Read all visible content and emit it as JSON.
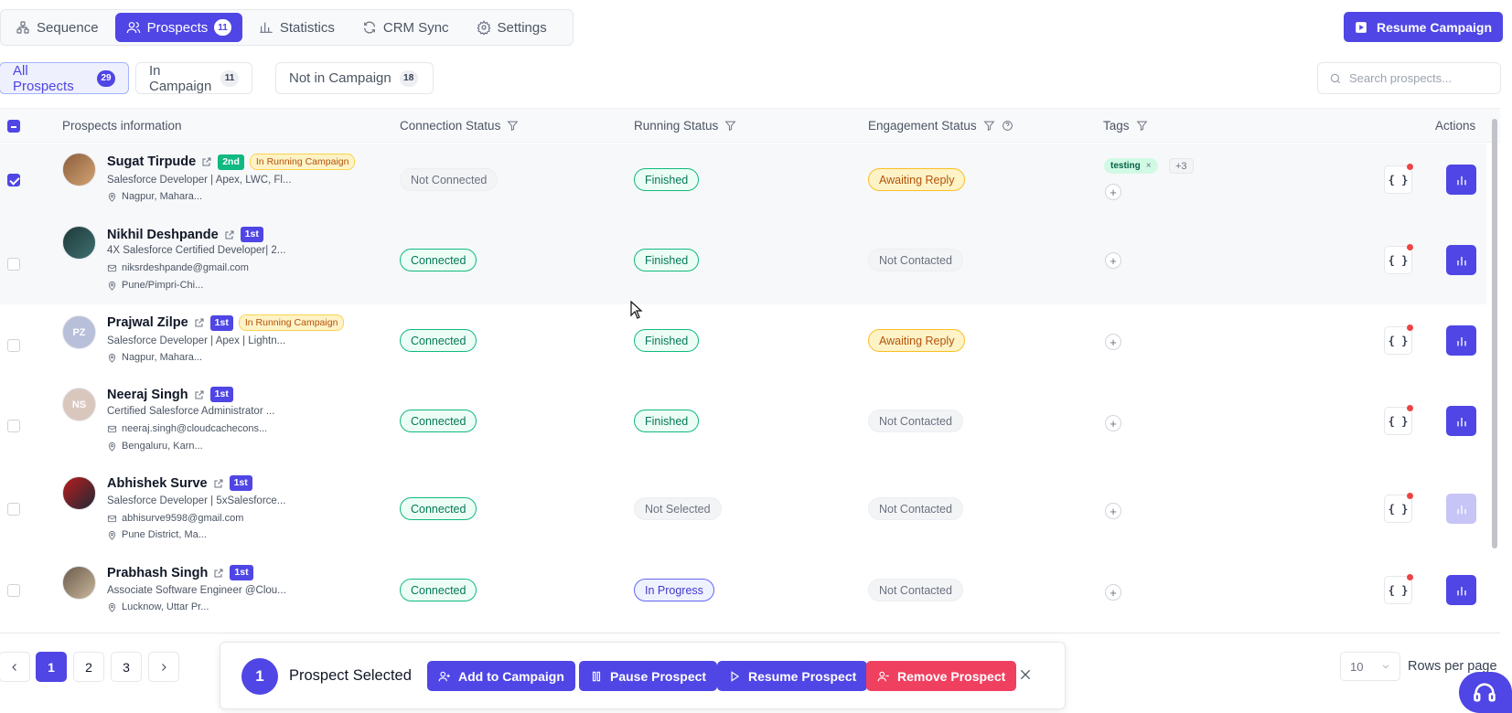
{
  "nav": {
    "tabs": [
      {
        "label": "Sequence",
        "icon": "sequence-icon"
      },
      {
        "label": "Prospects",
        "icon": "users-icon",
        "badge": "11"
      },
      {
        "label": "Statistics",
        "icon": "bar-chart-icon"
      },
      {
        "label": "CRM Sync",
        "icon": "sync-icon"
      },
      {
        "label": "Settings",
        "icon": "gear-icon"
      }
    ],
    "resume_campaign": "Resume Campaign"
  },
  "filters": {
    "tabs": [
      {
        "label": "All Prospects",
        "count": "29"
      },
      {
        "label": "In Campaign",
        "count": "11"
      },
      {
        "label": "Not in Campaign",
        "count": "18"
      }
    ],
    "search_placeholder": "Search prospects..."
  },
  "table": {
    "headers": {
      "info": "Prospects information",
      "connection": "Connection Status",
      "running": "Running Status",
      "engagement": "Engagement Status",
      "tags": "Tags",
      "actions": "Actions"
    },
    "rows": [
      {
        "name": "Sugat Tirpude",
        "degree": "2nd",
        "campaign_badge": "In Running Campaign",
        "title": "Salesforce Developer | Apex, LWC, Fl...",
        "email": "",
        "location": "Nagpur, Mahara...",
        "connection": "Not Connected",
        "running": "Finished",
        "engagement": "Awaiting Reply",
        "tag": "testing",
        "tag_more": "+3",
        "selected": true
      },
      {
        "name": "Nikhil Deshpande",
        "degree": "1st",
        "campaign_badge": "",
        "title": "4X Salesforce Certified Developer| 2...",
        "email": "niksrdeshpande@gmail.com",
        "location": "Pune/Pimpri-Chi...",
        "connection": "Connected",
        "running": "Finished",
        "engagement": "Not Contacted",
        "tag": "",
        "tag_more": "",
        "selected": false
      },
      {
        "name": "Prajwal Zilpe",
        "degree": "1st",
        "campaign_badge": "In Running Campaign",
        "title": "Salesforce Developer | Apex | Lightn...",
        "email": "",
        "location": "Nagpur, Mahara...",
        "connection": "Connected",
        "running": "Finished",
        "engagement": "Awaiting Reply",
        "tag": "",
        "tag_more": "",
        "selected": false,
        "initials": "PZ"
      },
      {
        "name": "Neeraj Singh",
        "degree": "1st",
        "campaign_badge": "",
        "title": "Certified Salesforce Administrator ...",
        "email": "neeraj.singh@cloudcachecons...",
        "location": "Bengaluru, Karn...",
        "connection": "Connected",
        "running": "Finished",
        "engagement": "Not Contacted",
        "tag": "",
        "tag_more": "",
        "selected": false,
        "initials": "NS"
      },
      {
        "name": "Abhishek Surve",
        "degree": "1st",
        "campaign_badge": "",
        "title": "Salesforce Developer | 5xSalesforce...",
        "email": "abhisurve9598@gmail.com",
        "location": "Pune District, Ma...",
        "connection": "Connected",
        "running": "Not Selected",
        "engagement": "Not Contacted",
        "tag": "",
        "tag_more": "",
        "selected": false
      },
      {
        "name": "Prabhash Singh",
        "degree": "1st",
        "campaign_badge": "",
        "title": "Associate Software Engineer @Clou...",
        "email": "",
        "location": "Lucknow, Uttar Pr...",
        "connection": "Connected",
        "running": "In Progress",
        "engagement": "Not Contacted",
        "tag": "",
        "tag_more": "",
        "selected": false
      }
    ],
    "variables_label": "{ }"
  },
  "pagination": {
    "pages": [
      "1",
      "2",
      "3"
    ],
    "current": "1",
    "rows_per_page": "10",
    "rows_label": "Rows per page"
  },
  "selection": {
    "count": "1",
    "label": "Prospect Selected",
    "add": "Add to Campaign",
    "pause": "Pause Prospect",
    "resume": "Resume Prospect",
    "remove": "Remove Prospect"
  },
  "colors": {
    "accent": "#4f46e5",
    "danger": "#ef4060",
    "success": "#10b981",
    "warning": "#fbbf24"
  }
}
